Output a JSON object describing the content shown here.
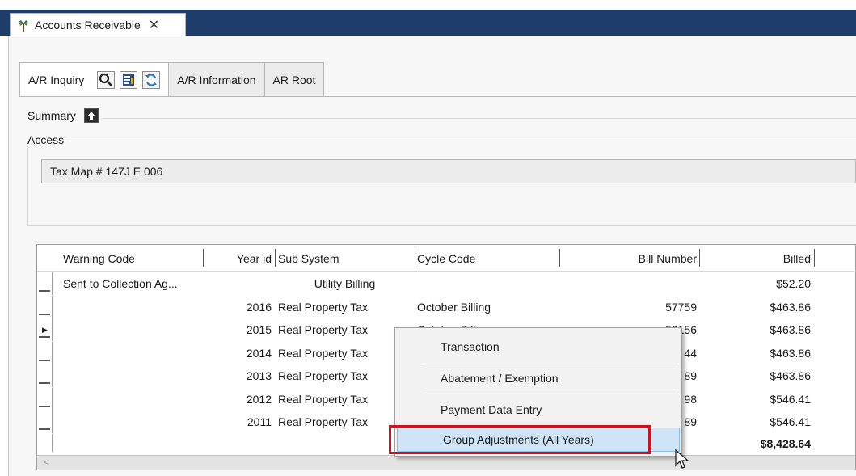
{
  "window": {
    "doc_tab_label": "Accounts Receivable",
    "close_glyph": "✕",
    "app_icon": "palm-tree-icon"
  },
  "tabs": [
    {
      "label": "A/R Inquiry",
      "active": true
    },
    {
      "label": "A/R Information",
      "active": false
    },
    {
      "label": "AR Root",
      "active": false
    }
  ],
  "toolbar_icons": [
    "search-icon",
    "report-icon",
    "refresh-icon"
  ],
  "summary": {
    "label": "Summary",
    "icon": "export-icon"
  },
  "access": {
    "label": "Access",
    "value": "Tax Map # 147J E 006"
  },
  "grid": {
    "columns": [
      "Warning Code",
      "Year id",
      "Sub System",
      "Cycle Code",
      "Bill Number",
      "Billed"
    ],
    "rows": [
      {
        "warning": "Sent to Collection Ag...",
        "year": "",
        "sub": "Utility Billing",
        "cycle": "",
        "bill": "",
        "billed": "$52.20",
        "current": false
      },
      {
        "warning": "",
        "year": "2016",
        "sub": "Real Property Tax",
        "cycle": "October Billing",
        "bill": "57759",
        "billed": "$463.86",
        "current": false
      },
      {
        "warning": "",
        "year": "2015",
        "sub": "Real Property Tax",
        "cycle": "October Billing",
        "bill": "59156",
        "billed": "$463.86",
        "current": true
      },
      {
        "warning": "",
        "year": "2014",
        "sub": "Real Property Tax",
        "cycle": "",
        "bill": "44",
        "billed": "$463.86",
        "current": false
      },
      {
        "warning": "",
        "year": "2013",
        "sub": "Real Property Tax",
        "cycle": "",
        "bill": "89",
        "billed": "$463.86",
        "current": false
      },
      {
        "warning": "",
        "year": "2012",
        "sub": "Real Property Tax",
        "cycle": "",
        "bill": "98",
        "billed": "$546.41",
        "current": false
      },
      {
        "warning": "",
        "year": "2011",
        "sub": "Real Property Tax",
        "cycle": "",
        "bill": "89",
        "billed": "$546.41",
        "current": false
      }
    ],
    "total": "$8,428.64"
  },
  "context_menu": {
    "items": [
      {
        "label": "Transaction",
        "highlighted": false
      },
      {
        "label": "Abatement / Exemption",
        "highlighted": false
      },
      {
        "label": "Payment Data Entry",
        "highlighted": false
      },
      {
        "label": "Group Adjustments (All Years)",
        "highlighted": true
      }
    ]
  },
  "colors": {
    "title_bar": "#1f3d6b",
    "highlight": "#cfe4f7",
    "callout": "#d0101a"
  }
}
